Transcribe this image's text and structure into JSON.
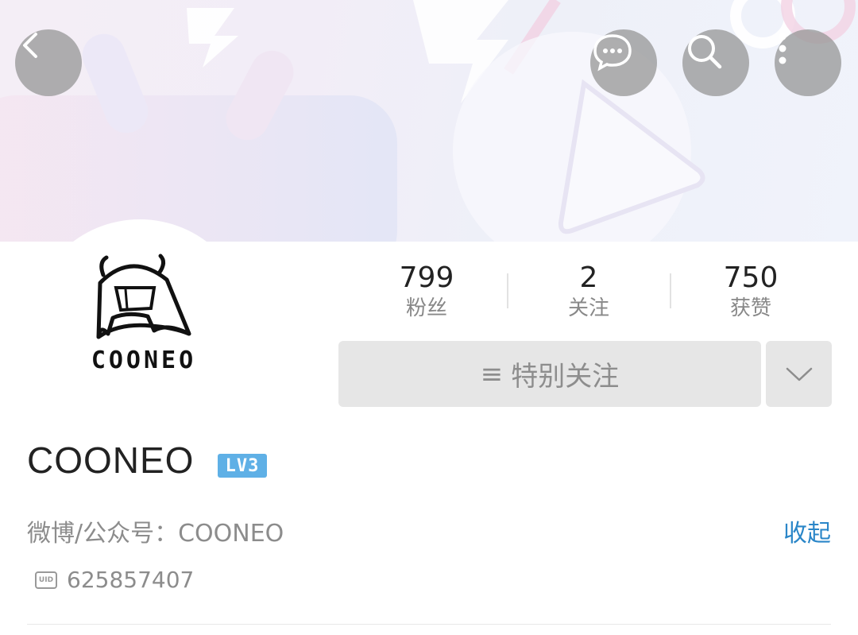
{
  "header": {
    "back_icon": "chevron-left-icon",
    "message_icon": "chat-bubble-icon",
    "search_icon": "search-icon",
    "more_icon": "more-vertical-icon"
  },
  "profile": {
    "avatar_text": "COONEO",
    "name": "COONEO",
    "level_badge": "LV3",
    "description": "微博/公众号：COONEO",
    "collapse_label": "收起",
    "uid": "625857407"
  },
  "stats": [
    {
      "value": "799",
      "label": "粉丝"
    },
    {
      "value": "2",
      "label": "关注"
    },
    {
      "value": "750",
      "label": "获赞"
    }
  ],
  "actions": {
    "follow_label": "特别关注",
    "follow_icon": "≡"
  },
  "colors": {
    "accent_link": "#2a86c8",
    "level_badge": "#5fb0e6",
    "button_bg": "#e6e6e6"
  }
}
